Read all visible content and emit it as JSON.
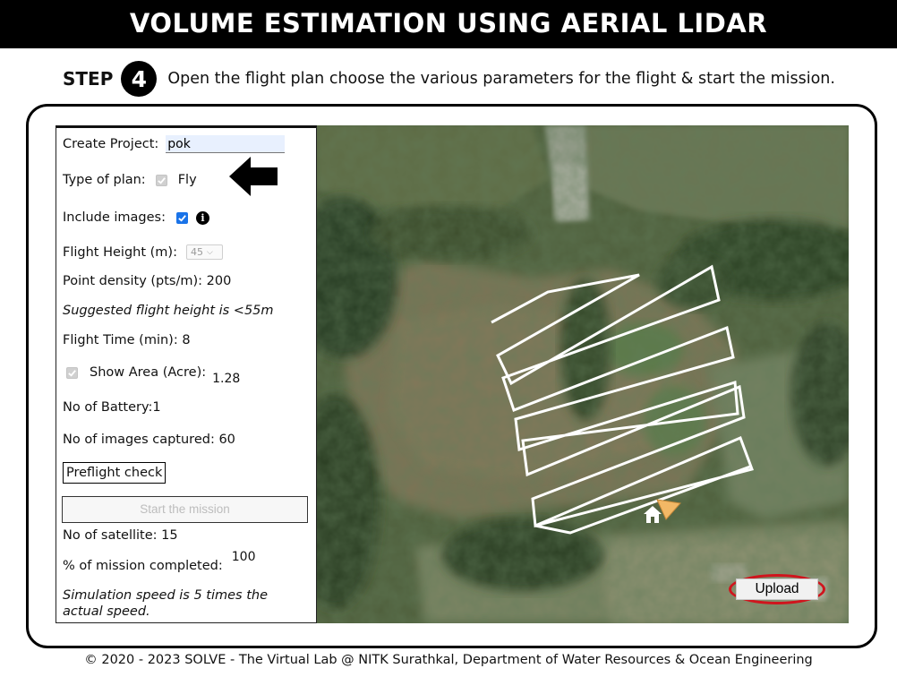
{
  "app": {
    "title": "VOLUME ESTIMATION USING AERIAL LIDAR"
  },
  "step": {
    "label": "STEP",
    "number": "4",
    "instruction": "Open the flight plan choose the various parameters for the flight & start the mission."
  },
  "panel": {
    "create_project_label": "Create Project:",
    "create_project_value": "pok",
    "type_of_plan_label": "Type of plan:",
    "type_of_plan_value": "Fly",
    "include_images_label": "Include images:",
    "flight_height_label": "Flight Height (m):",
    "flight_height_value": "45",
    "point_density": "Point density (pts/m): 200",
    "suggested_height": "Suggested flight height is <55m",
    "flight_time": "Flight Time (min): 8",
    "show_area_label": "Show Area (Acre):",
    "show_area_value": "1.28",
    "batteries": "No of Battery:1",
    "images_captured": "No of images captured: 60",
    "preflight_label": "Preflight check",
    "start_label": "Start the mission",
    "satellites": "No of satellite: 15",
    "mission_completed_label": "% of mission completed:",
    "mission_completed_value": "100",
    "sim_speed_line1": "Simulation speed is 5 times the",
    "sim_speed_line2": "actual speed."
  },
  "map": {
    "upload_label": "Upload"
  },
  "footer": {
    "text": "© 2020 - 2023 SOLVE - The Virtual Lab @ NITK Surathkal, Department of Water Resources & Ocean Engineering"
  },
  "colors": {
    "title_bg": "#000000",
    "checkbox_checked": "#1a73e8",
    "highlight_ring": "#d0141d",
    "flight_path": "#ffffff",
    "drone_marker": "#f2b866"
  },
  "icons": [
    "info-icon",
    "arrow-left-icon",
    "home-icon",
    "drone-marker-icon",
    "checkmark-icon"
  ]
}
